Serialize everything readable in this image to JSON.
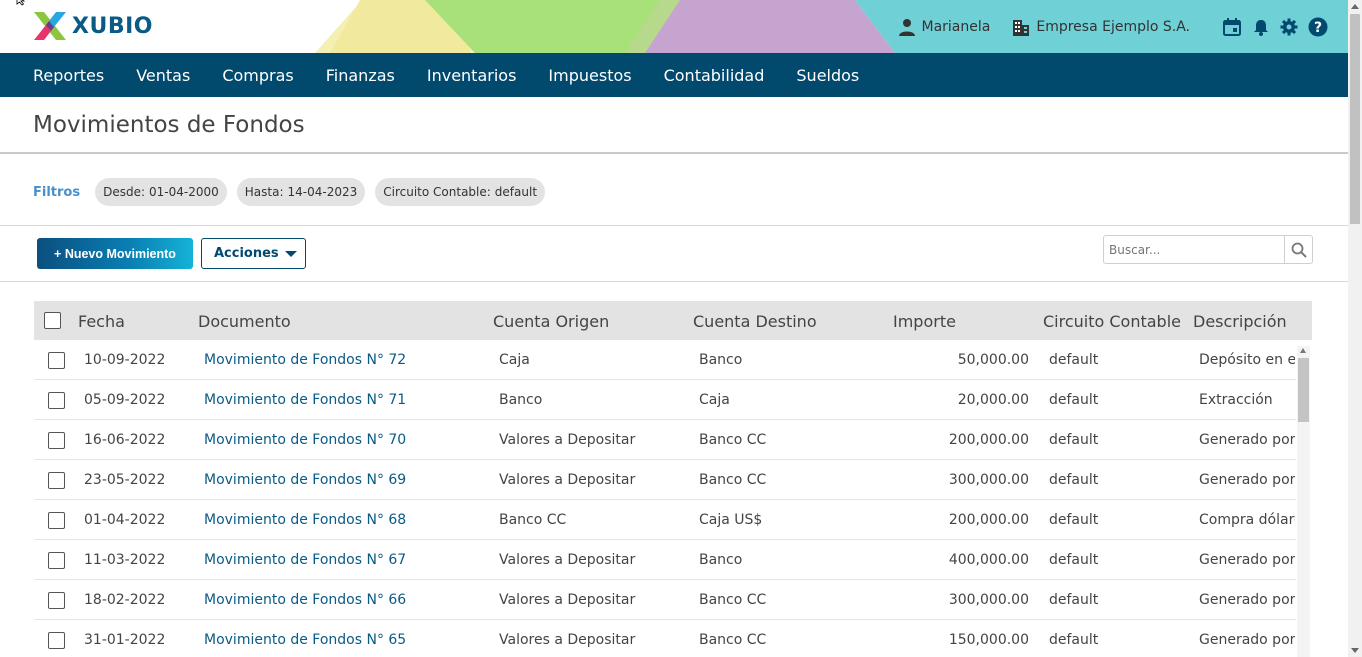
{
  "brand": {
    "name": "XUBIO"
  },
  "header": {
    "user": "Marianela",
    "company": "Empresa Ejemplo S.A.",
    "icons": [
      "user-icon",
      "building-icon",
      "calendar-icon",
      "bell-icon",
      "gear-icon",
      "help-icon"
    ]
  },
  "nav": {
    "items": [
      {
        "label": "Reportes"
      },
      {
        "label": "Ventas"
      },
      {
        "label": "Compras"
      },
      {
        "label": "Finanzas"
      },
      {
        "label": "Inventarios"
      },
      {
        "label": "Impuestos"
      },
      {
        "label": "Contabilidad"
      },
      {
        "label": "Sueldos"
      }
    ]
  },
  "page": {
    "title": "Movimientos de Fondos"
  },
  "filters": {
    "label": "Filtros",
    "chips": [
      {
        "key": "Desde:",
        "value": "01-04-2000"
      },
      {
        "key": "Hasta:",
        "value": "14-04-2023"
      },
      {
        "key": "Circuito Contable:",
        "value": "default"
      }
    ]
  },
  "toolbar": {
    "new_label": "+ Nuevo Movimiento",
    "actions_label": "Acciones",
    "search_placeholder": "Buscar..."
  },
  "table": {
    "columns": [
      "Fecha",
      "Documento",
      "Cuenta Origen",
      "Cuenta Destino",
      "Importe",
      "Circuito Contable",
      "Descripción"
    ],
    "rows": [
      {
        "fecha": "10-09-2022",
        "documento": "Movimiento de Fondos N° 72",
        "origen": "Caja",
        "destino": "Banco",
        "importe": "50,000.00",
        "circuito": "default",
        "descripcion": "Depósito en efe"
      },
      {
        "fecha": "05-09-2022",
        "documento": "Movimiento de Fondos N° 71",
        "origen": "Banco",
        "destino": "Caja",
        "importe": "20,000.00",
        "circuito": "default",
        "descripcion": "Extracción"
      },
      {
        "fecha": "16-06-2022",
        "documento": "Movimiento de Fondos N° 70",
        "origen": "Valores a Depositar",
        "destino": "Banco CC",
        "importe": "200,000.00",
        "circuito": "default",
        "descripcion": "Generado por l"
      },
      {
        "fecha": "23-05-2022",
        "documento": "Movimiento de Fondos N° 69",
        "origen": "Valores a Depositar",
        "destino": "Banco CC",
        "importe": "300,000.00",
        "circuito": "default",
        "descripcion": "Generado por l"
      },
      {
        "fecha": "01-04-2022",
        "documento": "Movimiento de Fondos N° 68",
        "origen": "Banco CC",
        "destino": "Caja US$",
        "importe": "200,000.00",
        "circuito": "default",
        "descripcion": "Compra dólares"
      },
      {
        "fecha": "11-03-2022",
        "documento": "Movimiento de Fondos N° 67",
        "origen": "Valores a Depositar",
        "destino": "Banco",
        "importe": "400,000.00",
        "circuito": "default",
        "descripcion": "Generado por l"
      },
      {
        "fecha": "18-02-2022",
        "documento": "Movimiento de Fondos N° 66",
        "origen": "Valores a Depositar",
        "destino": "Banco CC",
        "importe": "300,000.00",
        "circuito": "default",
        "descripcion": "Generado por l"
      },
      {
        "fecha": "31-01-2022",
        "documento": "Movimiento de Fondos N° 65",
        "origen": "Valores a Depositar",
        "destino": "Banco CC",
        "importe": "150,000.00",
        "circuito": "default",
        "descripcion": "Generado por l"
      }
    ]
  },
  "colors": {
    "nav": "#02496e",
    "link": "#0a5a86",
    "filter_label": "#4a90c8",
    "header_band": "#6fd0d6"
  }
}
